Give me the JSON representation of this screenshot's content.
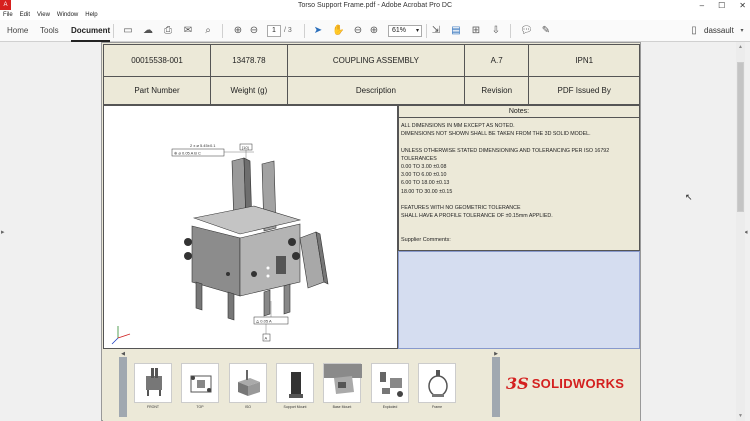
{
  "window": {
    "title": "Torso Support Frame.pdf - Adobe Acrobat Pro DC",
    "app_icon": "acrobat-icon",
    "controls": [
      "minimize-icon",
      "maximize-icon",
      "close-icon"
    ]
  },
  "menu": [
    "File",
    "Edit",
    "View",
    "Window",
    "Help"
  ],
  "toolbar": {
    "tabs": [
      "Home",
      "Tools",
      "Document"
    ],
    "active_tab": "Document",
    "current_page": "1",
    "page_total": "/ 3",
    "zoom": "61%",
    "user": "dassault"
  },
  "header_table": {
    "row1": [
      "00015538-001",
      "13478.78",
      "COUPLING ASSEMBLY",
      "A.7",
      "IPN1"
    ],
    "row2": [
      "Part Number",
      "Weight (g)",
      "Description",
      "Revision",
      "PDF Issued By"
    ]
  },
  "notes": {
    "heading": "Notes:",
    "lines": [
      "ALL DIMENSIONS IN MM EXCEPT AS NOTED.",
      "DIMENSIONS NOT SHOWN SHALL BE TAKEN FROM THE 3D SOLID MODEL.",
      "",
      "UNLESS OTHERWISE STATED DIMENSIONING AND TOLERANCING PER ISO 16792",
      "TOLERANCES",
      "0.00 TO 3.00 ±0.08",
      "3.00 TO 6.00 ±0.10",
      "6.00 TO 18.00 ±0.13",
      "18.00 TO 30.00 ±0.15",
      "",
      "FEATURES WITH NO GEOMETRIC TOLERANCE",
      "SHALL HAVE A PROFILE TOLERANCE OF ±0.15mm APPLIED."
    ],
    "supplier_label": "Supplier Comments:"
  },
  "model_annotations": {
    "callout_top": "2 x ⌀ 5.45±0.1",
    "callout_frame": "⊕ ⌀ 0.05 A B C",
    "callout_box": "[10]",
    "callout_bottom": "⌓ 0.05 A",
    "datum": "A"
  },
  "views": [
    "FRONT",
    "TOP",
    "ISO",
    "Support Mount",
    "Base Mount",
    "Exploded",
    "Frame"
  ],
  "brand": {
    "mark": "3S",
    "name": "SOLIDWORKS",
    "color": "#d4201f"
  }
}
